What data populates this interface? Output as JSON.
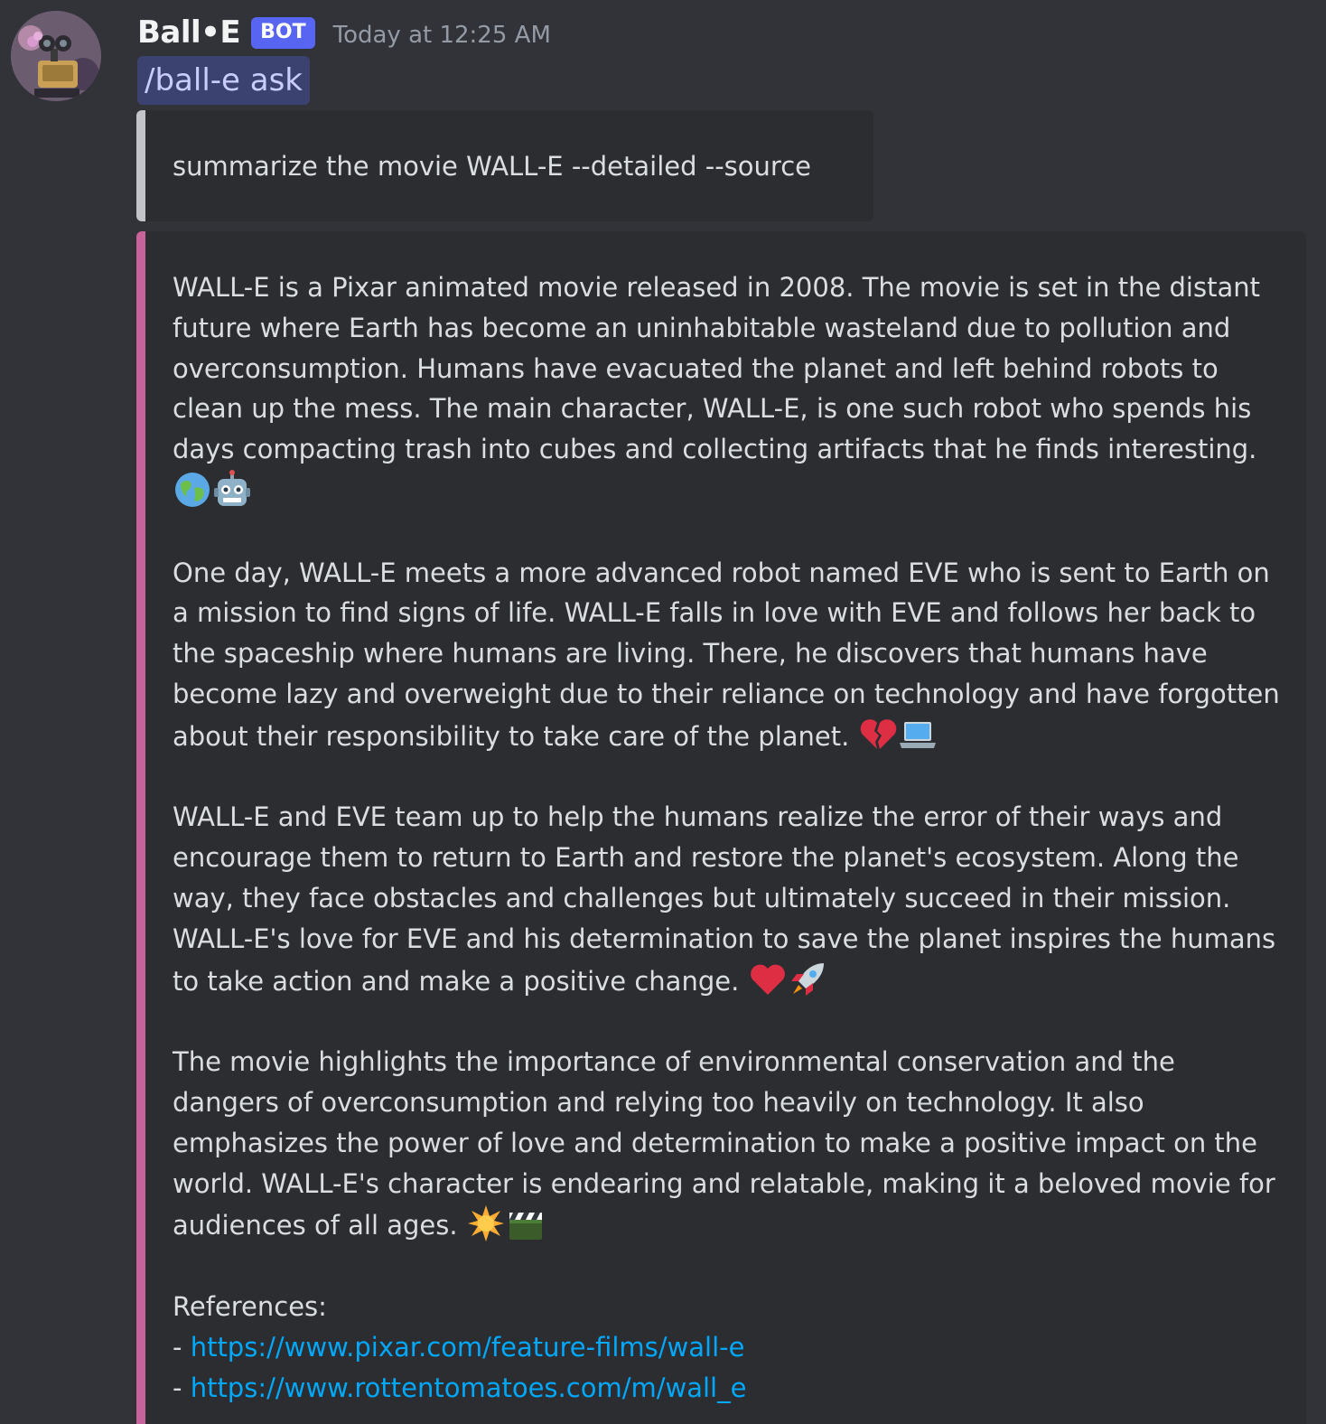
{
  "message": {
    "author": "Ball•E",
    "bot_tag": "BOT",
    "timestamp": "Today at 12:25 AM",
    "command": "/ball-e ask",
    "prompt": "summarize the movie WALL-E --detailed --source",
    "accent_color": "#c8629a",
    "paragraphs": [
      {
        "text": "WALL-E is a Pixar animated movie released in 2008. The movie is set in the distant future where Earth has become an uninhabitable wasteland due to pollution and overconsumption. Humans have evacuated the planet and left behind robots to clean up the mess. The main character, WALL-E, is one such robot who spends his days compacting trash into cubes and collecting artifacts that he finds interesting.",
        "emojis": [
          "globe-americas-emoji",
          "robot-emoji"
        ]
      },
      {
        "text": "One day, WALL-E meets a more advanced robot named EVE who is sent to Earth on a mission to find signs of life. WALL-E falls in love with EVE and follows her back to the spaceship where humans are living. There, he discovers that humans have become lazy and overweight due to their reliance on technology and have forgotten about their responsibility to take care of the planet.",
        "emojis": [
          "broken-heart-emoji",
          "laptop-emoji"
        ]
      },
      {
        "text": "WALL-E and EVE team up to help the humans realize the error of their ways and encourage them to return to Earth and restore the planet's ecosystem. Along the way, they face obstacles and challenges but ultimately succeed in their mission. WALL-E's love for EVE and his determination to save the planet inspires the humans to take action and make a positive change.",
        "emojis": [
          "red-heart-emoji",
          "rocket-emoji"
        ]
      },
      {
        "text": "The movie highlights the importance of environmental conservation and the dangers of overconsumption and relying too heavily on technology. It also emphasizes the power of love and determination to make a positive impact on the world. WALL-E's character is endearing and relatable, making it a beloved movie for audiences of all ages.",
        "emojis": [
          "sun-emoji",
          "clapper-board-emoji"
        ]
      }
    ],
    "references": {
      "heading": "References:",
      "bullet": "- ",
      "links": [
        "https://www.pixar.com/feature-films/wall-e",
        "https://www.rottentomatoes.com/m/wall_e"
      ]
    }
  }
}
